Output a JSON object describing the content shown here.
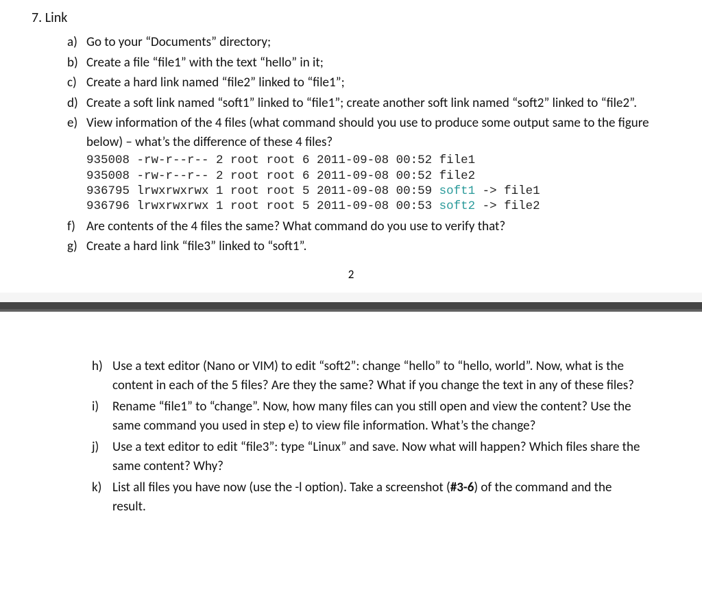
{
  "heading": {
    "number": "7.",
    "title": "Link"
  },
  "items1": [
    {
      "marker": "a)",
      "body": "Go to your “Documents” directory;"
    },
    {
      "marker": "b)",
      "body": "Create a file “file1” with the text “hello” in it;"
    },
    {
      "marker": "c)",
      "body": "Create a hard link named “file2” linked to “file1”;"
    },
    {
      "marker": "d)",
      "body": "Create a soft link named “soft1” linked to “file1”; create another soft link named “soft2” linked to “file2”."
    },
    {
      "marker": "e)",
      "body": "View information of the 4 files (what command should you use to produce some output same to the figure below) – what’s the difference of these 4 files?"
    }
  ],
  "terminal": {
    "l1a": "935008 -rw-r--r-- 2 root root 6 2011-09-08 00:52 file1",
    "l2a": "935008 -rw-r--r-- 2 root root 6 2011-09-08 00:52 file2",
    "l3a": "936795 lrwxrwxrwx 1 root root 5 2011-09-08 00:59 ",
    "l3s": "soft1",
    "l3b": " -> file1",
    "l4a": "936796 lrwxrwxrwx 1 root root 5 2011-09-08 00:53 ",
    "l4s": "soft2",
    "l4b": " -> file2"
  },
  "items1b": [
    {
      "marker": "f)",
      "body": "Are contents of the 4 files the same? What command do you use to verify that?"
    },
    {
      "marker": "g)",
      "body": "Create a hard link “file3” linked to “soft1”."
    }
  ],
  "page_number": "2",
  "items2": [
    {
      "marker": "h)",
      "body": "Use a text editor (Nano or VIM) to edit “soft2”: change “hello” to “hello, world”. Now, what is the content in each of the 5 files? Are they the same? What if you change the text in any of these files?"
    },
    {
      "marker": "i)",
      "body": "Rename “file1” to “change”. Now, how many files can you still open and view the content? Use the same command you used in step e) to view file information. What’s the change?"
    },
    {
      "marker": "j)",
      "body": "Use a text editor to edit “file3”: type “Linux” and save. Now what will happen? Which files share the same content? Why?"
    }
  ],
  "item_k": {
    "marker": "k)",
    "pre": "List all files you have now (use the -l option). Take a screenshot (",
    "bold": "#3-6",
    "post": ") of the command and the result."
  }
}
